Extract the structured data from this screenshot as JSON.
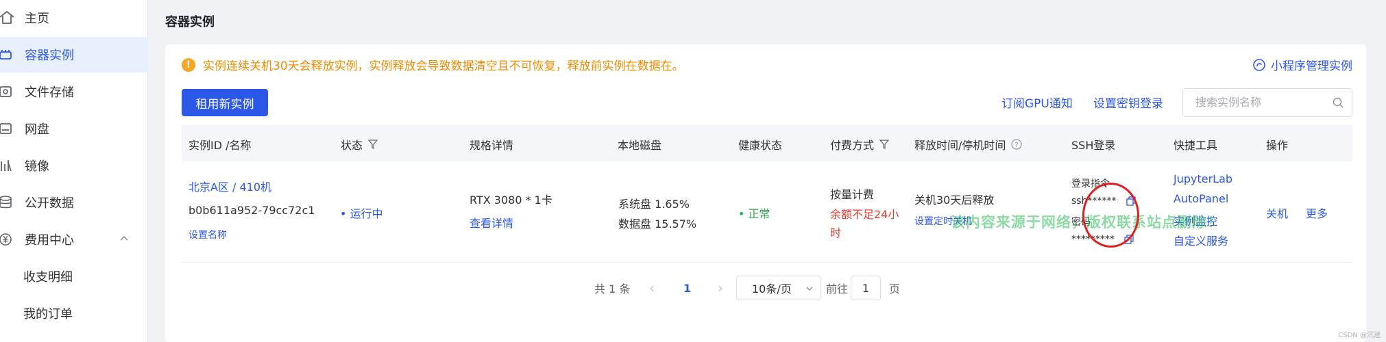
{
  "sidebar": {
    "items": [
      {
        "label": "主页",
        "icon": "home-icon"
      },
      {
        "label": "容器实例",
        "icon": "container-icon",
        "active": true
      },
      {
        "label": "文件存储",
        "icon": "storage-icon"
      },
      {
        "label": "网盘",
        "icon": "netdisk-icon"
      },
      {
        "label": "镜像",
        "icon": "image-icon"
      },
      {
        "label": "公开数据",
        "icon": "database-icon"
      },
      {
        "label": "费用中心",
        "icon": "yen-icon",
        "expanded": true
      },
      {
        "label": "收支明细"
      },
      {
        "label": "我的订单"
      }
    ]
  },
  "page": {
    "title": "容器实例"
  },
  "notice": {
    "text": "实例连续关机30天会释放实例，实例释放会导致数据清空且不可恢复，释放前实例在数据在。",
    "mini_program_link": "小程序管理实例"
  },
  "toolbar": {
    "rent_button": "租用新实例",
    "subscribe_gpu": "订阅GPU通知",
    "set_key_login": "设置密钥登录",
    "search_placeholder": "搜索实例名称"
  },
  "table": {
    "headers": [
      "实例ID /名称",
      "状态",
      "规格详情",
      "本地磁盘",
      "健康状态",
      "付费方式",
      "释放时间/停机时间",
      "SSH登录",
      "快捷工具",
      "操作"
    ],
    "row": {
      "name": "北京A区 / 410机",
      "id": "b0b611a952-79cc72c1",
      "set_name": "设置名称",
      "status": "• 运行中",
      "spec": "RTX 3080 * 1卡",
      "view_detail": "查看详情",
      "disk_system": "系统盘 1.65%",
      "disk_data": "数据盘 15.57%",
      "health": "• 正常",
      "billing": "按量计费",
      "balance_warn_1": "余额不足24小",
      "balance_warn_2": "时",
      "release": "关机30天后释放",
      "set_timer": "设置定时关机",
      "ssh_cmd_label": "登录指令",
      "ssh_cmd": "ssh******",
      "ssh_pwd_label": "密码",
      "ssh_pwd": "*********",
      "tools": [
        "JupyterLab",
        "AutoPanel",
        "实例监控",
        "自定义服务"
      ],
      "action_shutdown": "关机",
      "action_more": "更多"
    }
  },
  "pagination": {
    "total": "共 1 条",
    "prev": "‹",
    "current": "1",
    "next": "›",
    "page_size": "10条/页",
    "goto": "前往",
    "goto_value": "1",
    "page_unit": "页"
  },
  "watermark": "该内容来源于网络，版权联系站点删除！",
  "footer_mark": "CSDN @沉迷",
  "colors": {
    "accent": "#2b58e8",
    "warning": "#f08c00",
    "success": "#2ea84d",
    "danger": "#e23a2c"
  }
}
